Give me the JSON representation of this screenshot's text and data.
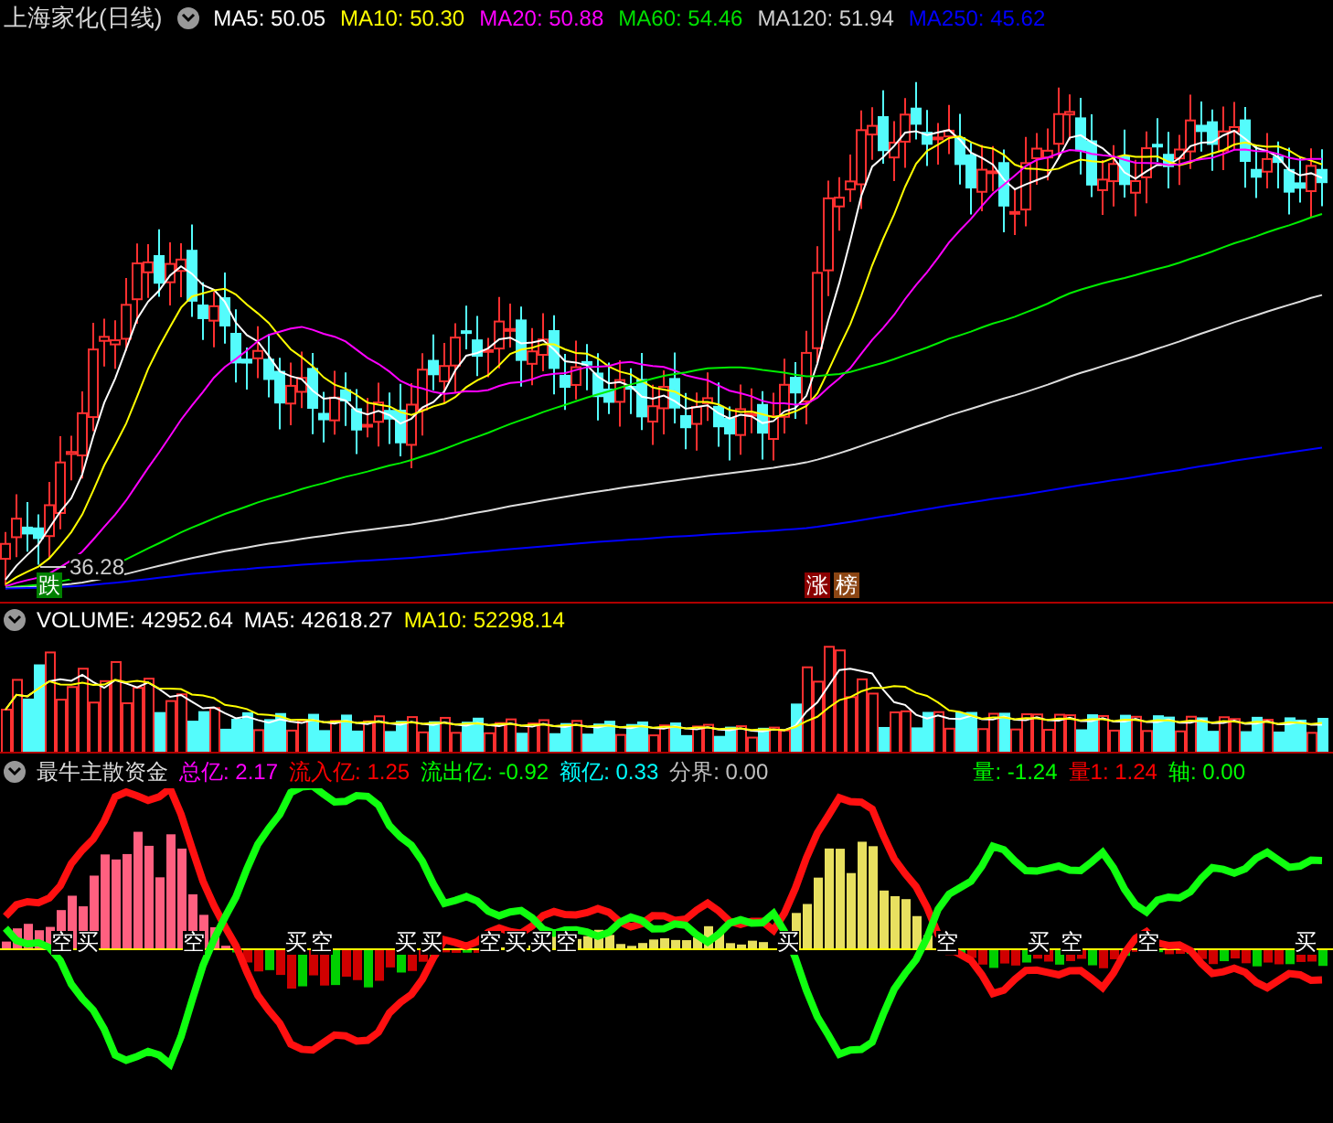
{
  "title": "上海家化(日线)",
  "main_indicators": [
    {
      "label": "MA5: 50.05",
      "color": "#ffffff"
    },
    {
      "label": "MA10: 50.30",
      "color": "#ffff00"
    },
    {
      "label": "MA20: 50.88",
      "color": "#ff00ff"
    },
    {
      "label": "MA60: 54.46",
      "color": "#00e000"
    },
    {
      "label": "MA120: 51.94",
      "color": "#d0d0d0"
    },
    {
      "label": "MA250: 45.62",
      "color": "#0000ff"
    }
  ],
  "low_price_label": "36.28",
  "badges": [
    {
      "text": "跌",
      "color": "#008000"
    },
    {
      "text": "涨",
      "color": "#8b0000"
    },
    {
      "text": "榜",
      "color": "#8b4513"
    }
  ],
  "volume": {
    "items": [
      {
        "label": "VOLUME: 42952.64",
        "color": "#ffffff"
      },
      {
        "label": "MA5: 42618.27",
        "color": "#ffffff"
      },
      {
        "label": "MA10: 52298.14",
        "color": "#ffff00"
      }
    ]
  },
  "fund_indicator": {
    "name": "最牛主散资金",
    "items": [
      {
        "label": "总亿: 2.17",
        "color": "#ff00ff"
      },
      {
        "label": "流入亿: 1.25",
        "color": "#ff0000"
      },
      {
        "label": "流出亿: -0.92",
        "color": "#00ff00"
      },
      {
        "label": "额亿: 0.33",
        "color": "#00ffff"
      },
      {
        "label": "分界: 0.00",
        "color": "#c0c0c0"
      }
    ],
    "right_items": [
      {
        "label": "量: -1.24",
        "color": "#00ff00"
      },
      {
        "label": "量1: 1.24",
        "color": "#ff0000"
      },
      {
        "label": "轴: 0.00",
        "color": "#00ff00"
      }
    ],
    "signals": [
      {
        "text": "空"
      },
      {
        "text": "买"
      },
      {
        "text": "空"
      },
      {
        "text": "买"
      },
      {
        "text": "空"
      },
      {
        "text": "买"
      },
      {
        "text": "买"
      },
      {
        "text": "空"
      },
      {
        "text": "买"
      },
      {
        "text": "买"
      },
      {
        "text": "空"
      },
      {
        "text": "买"
      },
      {
        "text": "空"
      },
      {
        "text": "买"
      },
      {
        "text": "空"
      },
      {
        "text": "空"
      },
      {
        "text": "买"
      }
    ]
  }
}
